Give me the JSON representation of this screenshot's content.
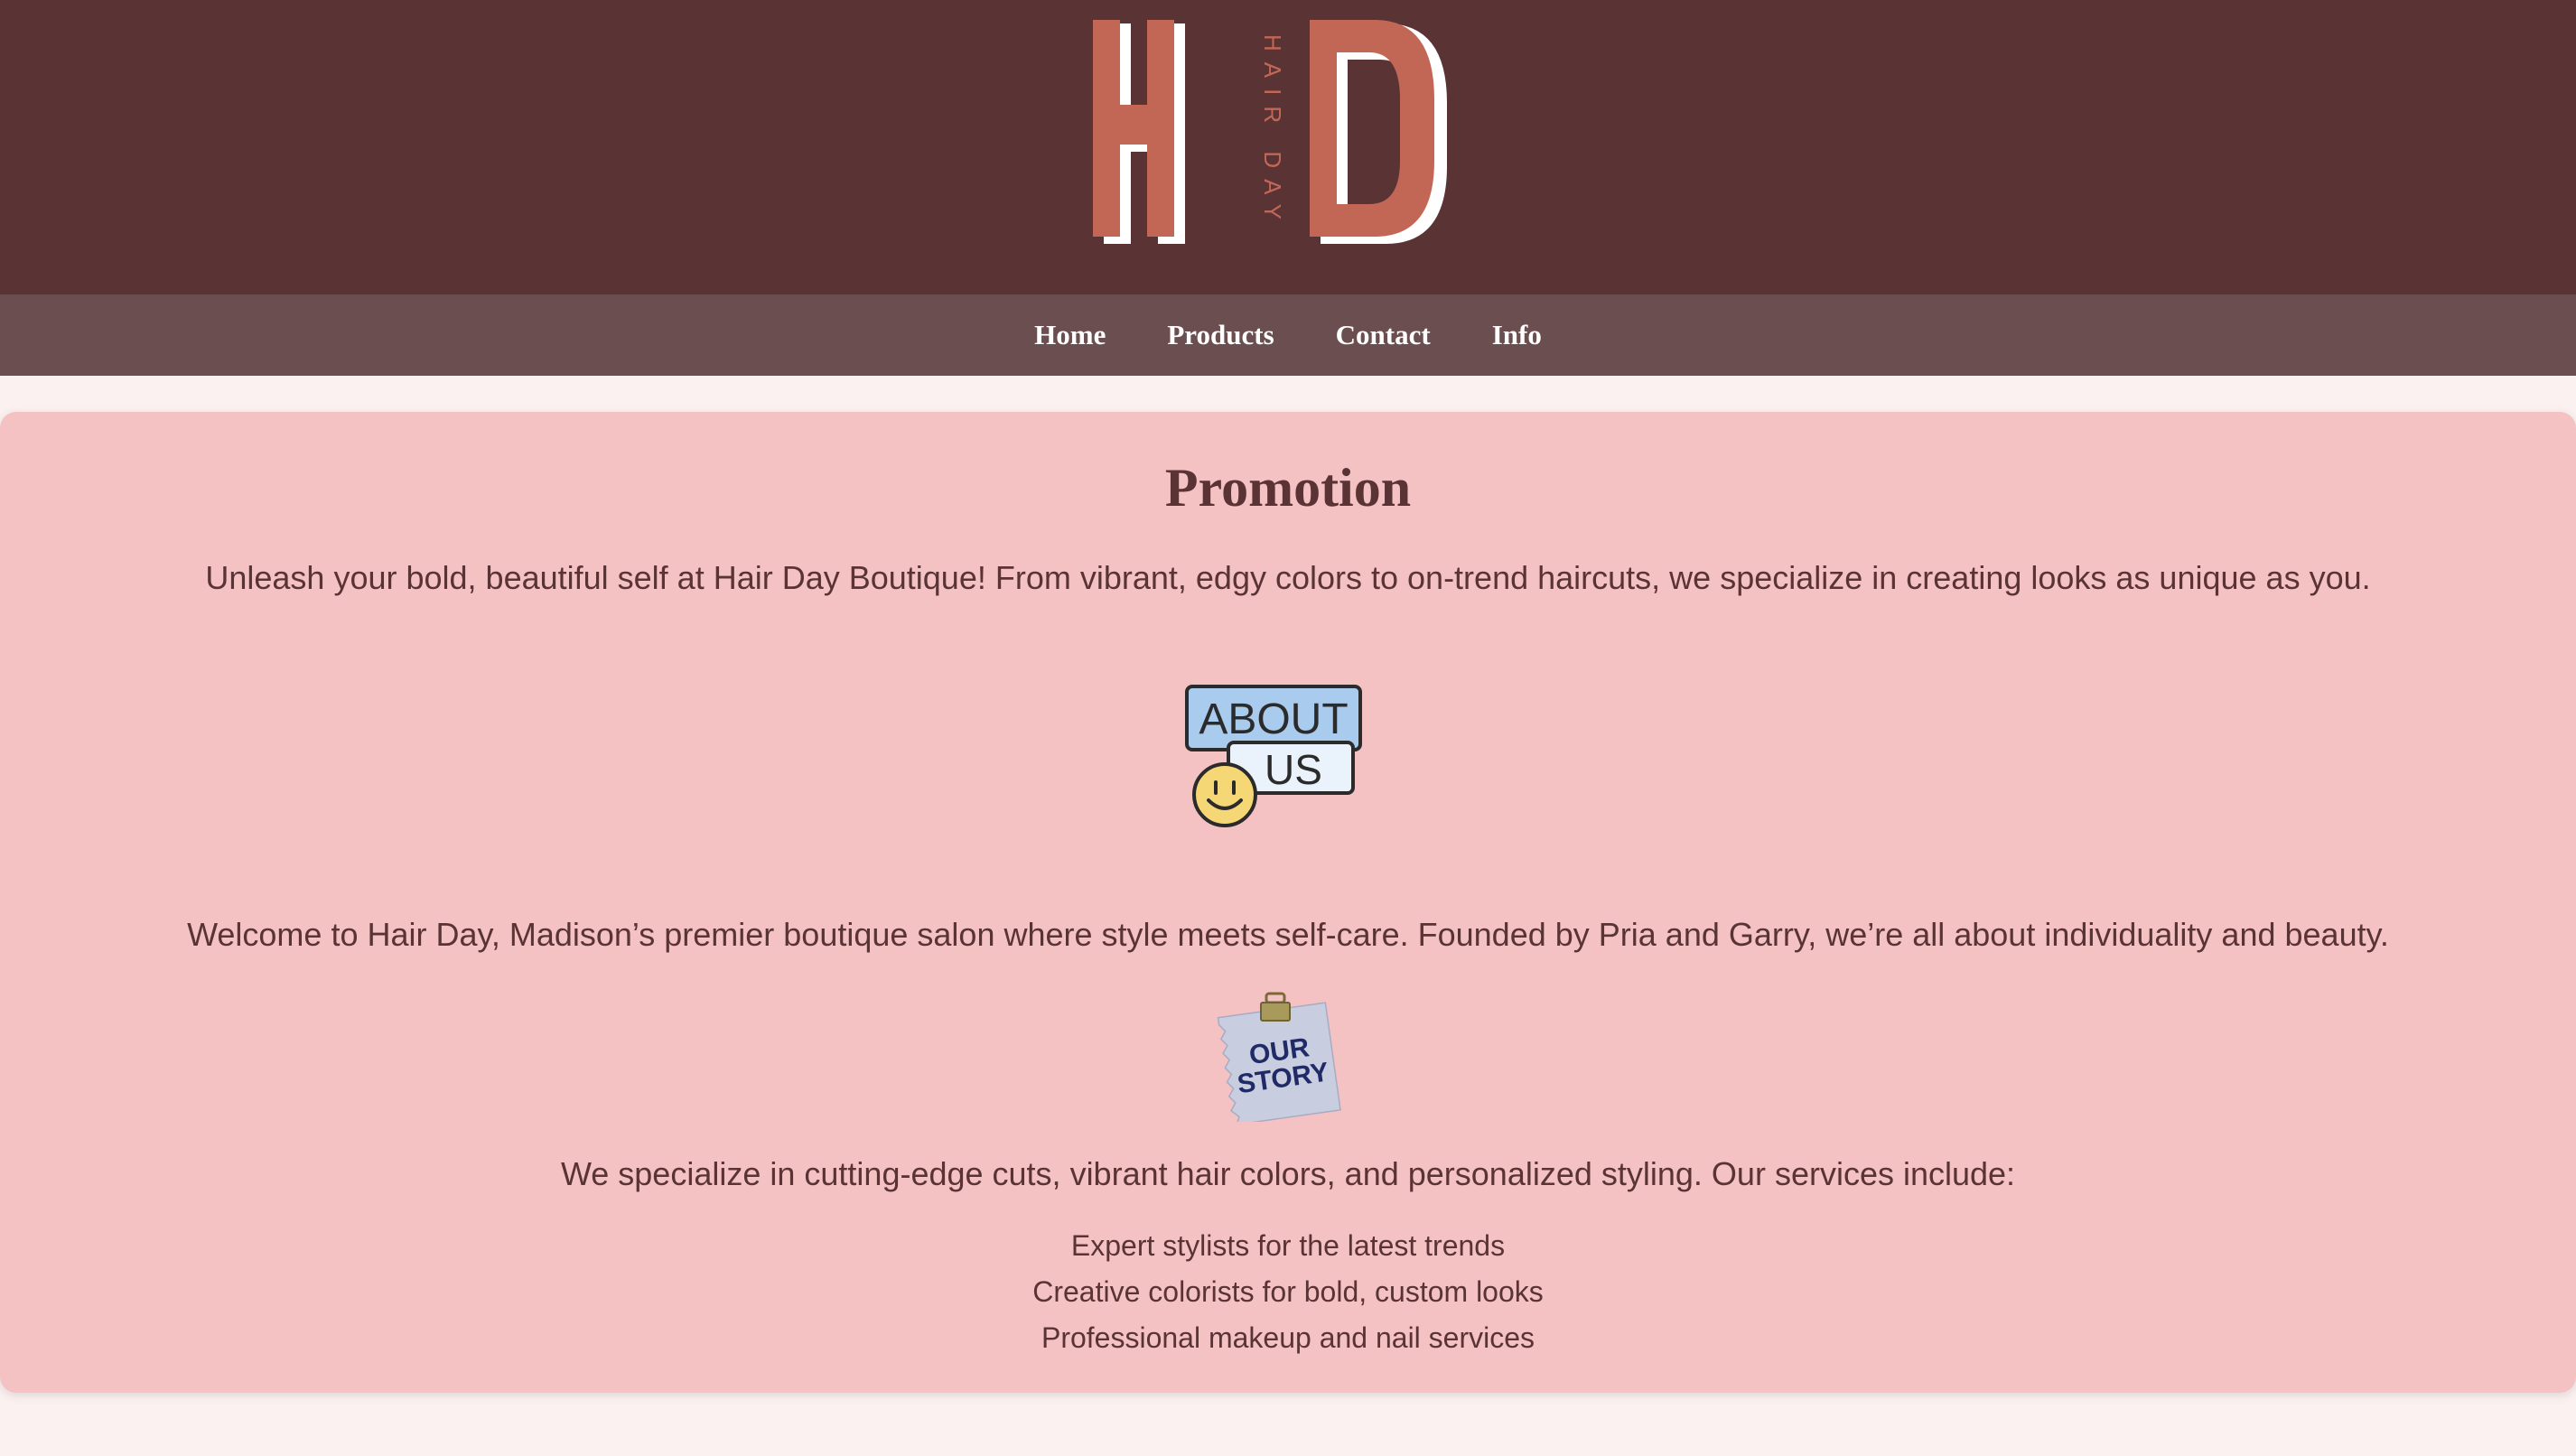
{
  "logo": {
    "left_letter": "H",
    "right_letter": "D",
    "tagline": "HAIR DAY"
  },
  "nav": {
    "items": [
      "Home",
      "Products",
      "Contact",
      "Info"
    ]
  },
  "promo": {
    "title": "Promotion",
    "intro": "Unleash your bold, beautiful self at Hair Day Boutique! From vibrant, edgy colors to on-trend haircuts, we specialize in creating looks as unique as you.",
    "about_badge": {
      "line1": "ABOUT",
      "line2": "US"
    },
    "welcome": "Welcome to Hair Day, Madison’s premier boutique salon where style meets self-care. Founded by Pria and Garry, we’re all about individuality and beauty.",
    "story_note": {
      "line1": "OUR",
      "line2": "STORY"
    },
    "services_intro": "We specialize in cutting-edge cuts, vibrant hair colors, and personalized styling. Our services include:",
    "services": [
      "Expert stylists for the latest trends",
      "Creative colorists for bold, custom looks",
      "Professional makeup and nail services"
    ]
  },
  "colors": {
    "header_bg": "#5a3435",
    "nav_bg": "#6b4e50",
    "promo_bg": "#f5c2c3",
    "page_bg": "#faf1f0",
    "accent": "#c26755",
    "text": "#5a3435"
  }
}
